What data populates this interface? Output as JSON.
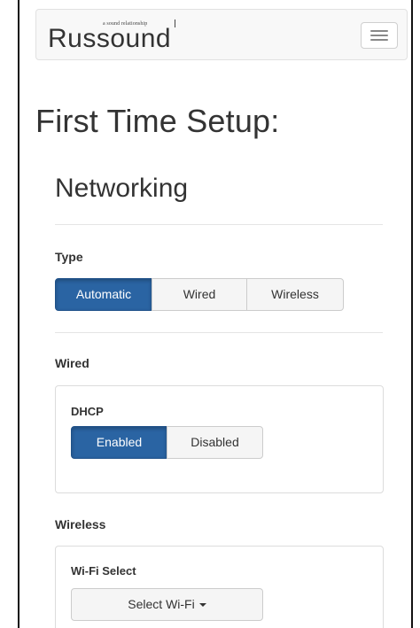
{
  "header": {
    "logo_text": "Russound",
    "logo_tagline": "a sound relationship",
    "menu_icon": "hamburger-menu-icon"
  },
  "page": {
    "title": "First Time Setup:"
  },
  "networking": {
    "title": "Networking",
    "type": {
      "label": "Type",
      "options": [
        "Automatic",
        "Wired",
        "Wireless"
      ],
      "selected": "Automatic"
    },
    "wired": {
      "label": "Wired",
      "dhcp": {
        "label": "DHCP",
        "options": [
          "Enabled",
          "Disabled"
        ],
        "selected": "Enabled"
      }
    },
    "wireless": {
      "label": "Wireless",
      "wifi_select": {
        "label": "Wi-Fi Select",
        "button_label": "Select Wi-Fi"
      }
    }
  },
  "colors": {
    "active_button": "#2a64a3",
    "navbar_bg": "#f8f8f8"
  }
}
